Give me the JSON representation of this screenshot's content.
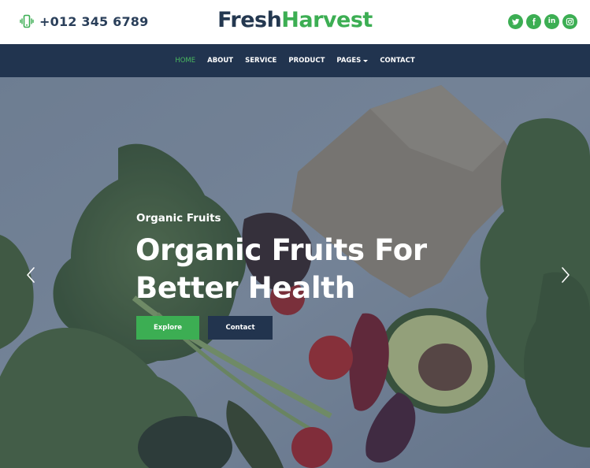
{
  "header": {
    "phone": "+012 345 6789",
    "logo_part1": "Fresh",
    "logo_part2": "Harvest",
    "socials": [
      {
        "icon": "twitter-icon"
      },
      {
        "icon": "facebook-icon"
      },
      {
        "icon": "linkedin-icon",
        "text": "in"
      },
      {
        "icon": "instagram-icon"
      }
    ]
  },
  "nav": {
    "items": [
      {
        "label": "HOME",
        "active": true
      },
      {
        "label": "ABOUT"
      },
      {
        "label": "SERVICE"
      },
      {
        "label": "PRODUCT"
      },
      {
        "label": "PAGES",
        "dropdown": true
      },
      {
        "label": "CONTACT"
      }
    ]
  },
  "hero": {
    "eyebrow": "Organic Fruits",
    "headline": "Organic Fruits For Better Health",
    "explore_label": "Explore",
    "contact_label": "Contact"
  },
  "colors": {
    "accent": "#3cae53",
    "navy": "#21344f",
    "text_dark": "#243850"
  }
}
